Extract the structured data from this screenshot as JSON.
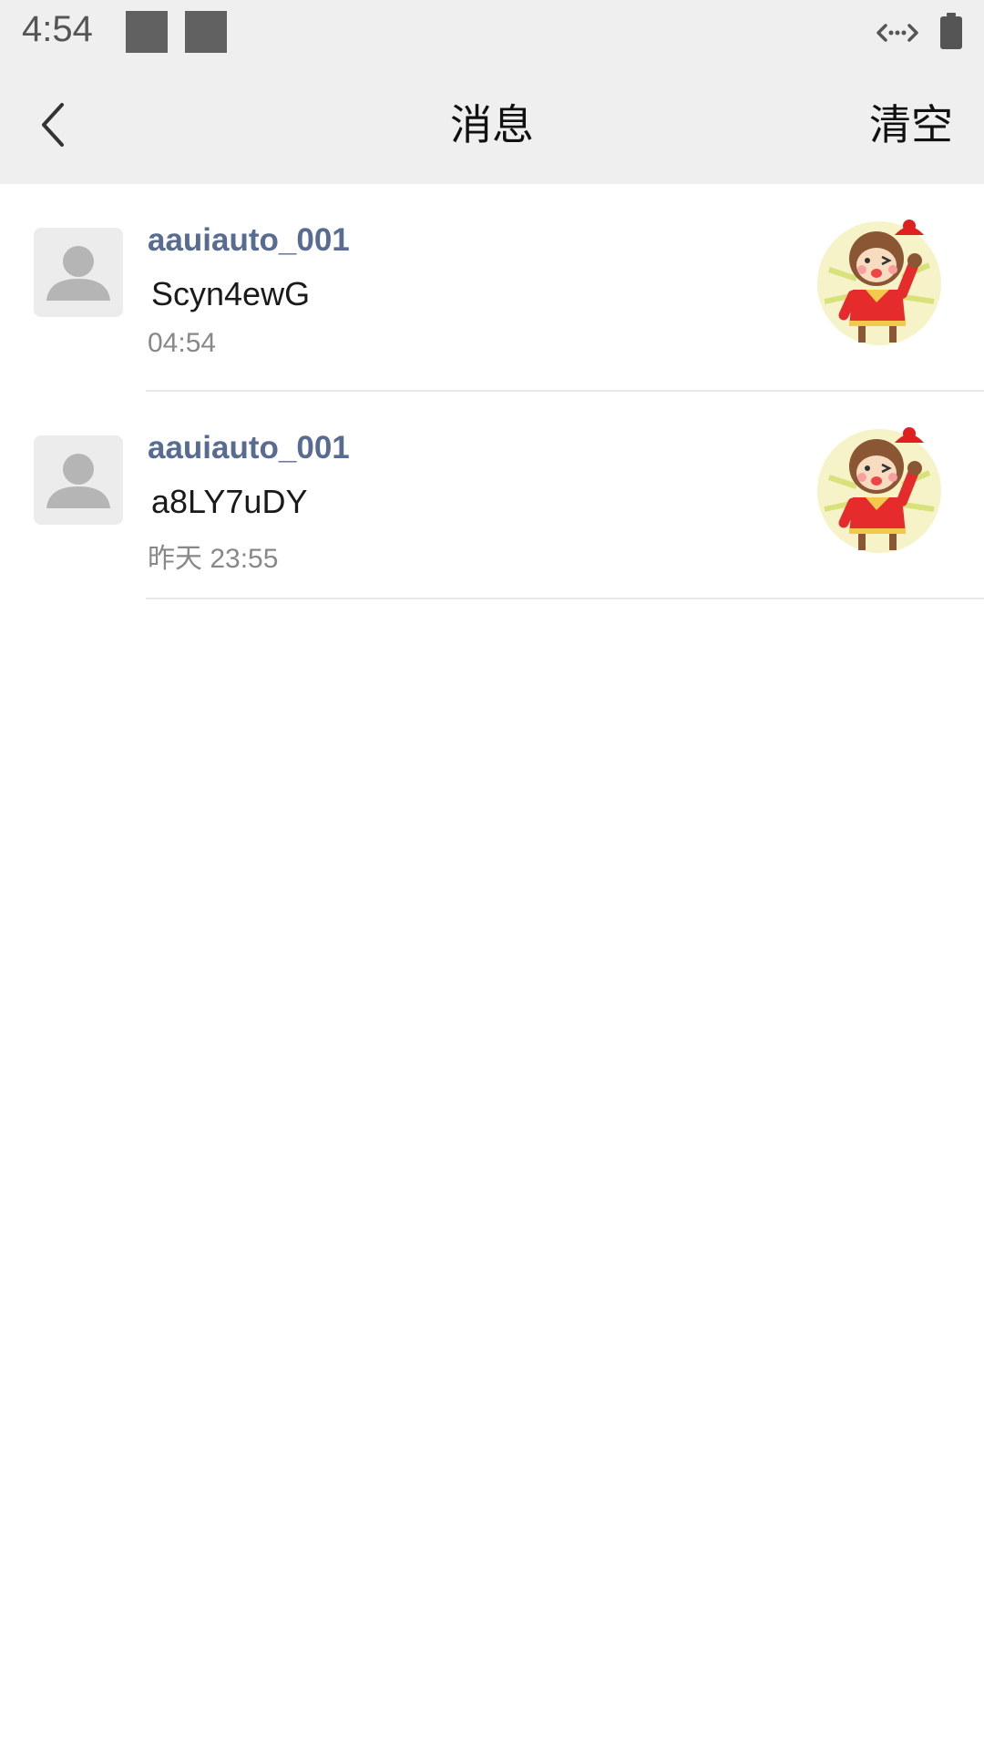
{
  "status_bar": {
    "time": "4:54",
    "icons": [
      "notification-square",
      "notification-square",
      "data-transfer-icon",
      "battery-icon"
    ]
  },
  "header": {
    "back_icon": "chevron-left-icon",
    "title": "消息",
    "clear_label": "清空"
  },
  "messages": [
    {
      "name": "aauiauto_001",
      "text": "Scyn4ewG",
      "time": "04:54",
      "avatar_icon": "default-user-icon",
      "sticker_icon": "monkey-sticker-icon"
    },
    {
      "name": "aauiauto_001",
      "text": "a8LY7uDY",
      "time": "昨天 23:55",
      "avatar_icon": "default-user-icon",
      "sticker_icon": "monkey-sticker-icon"
    }
  ],
  "colors": {
    "bar_background": "#efefef",
    "name_color": "#586b91",
    "time_color": "#888888",
    "divider": "#e8e8e8"
  }
}
